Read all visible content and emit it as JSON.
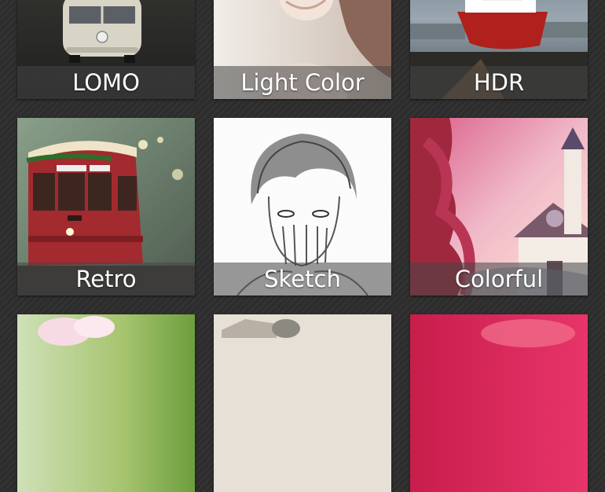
{
  "filters": [
    {
      "label": "LOMO",
      "icon": "lomo-van-thumbnail"
    },
    {
      "label": "Light Color",
      "icon": "light-color-portrait-thumbnail"
    },
    {
      "label": "HDR",
      "icon": "hdr-ship-thumbnail"
    },
    {
      "label": "Retro",
      "icon": "retro-tram-thumbnail"
    },
    {
      "label": "Sketch",
      "icon": "sketch-drawing-thumbnail"
    },
    {
      "label": "Colorful",
      "icon": "colorful-church-thumbnail"
    },
    {
      "label": "",
      "icon": "flower-thumbnail"
    },
    {
      "label": "",
      "icon": "vintage-landscape-thumbnail"
    },
    {
      "label": "",
      "icon": "pink-thumbnail"
    }
  ]
}
